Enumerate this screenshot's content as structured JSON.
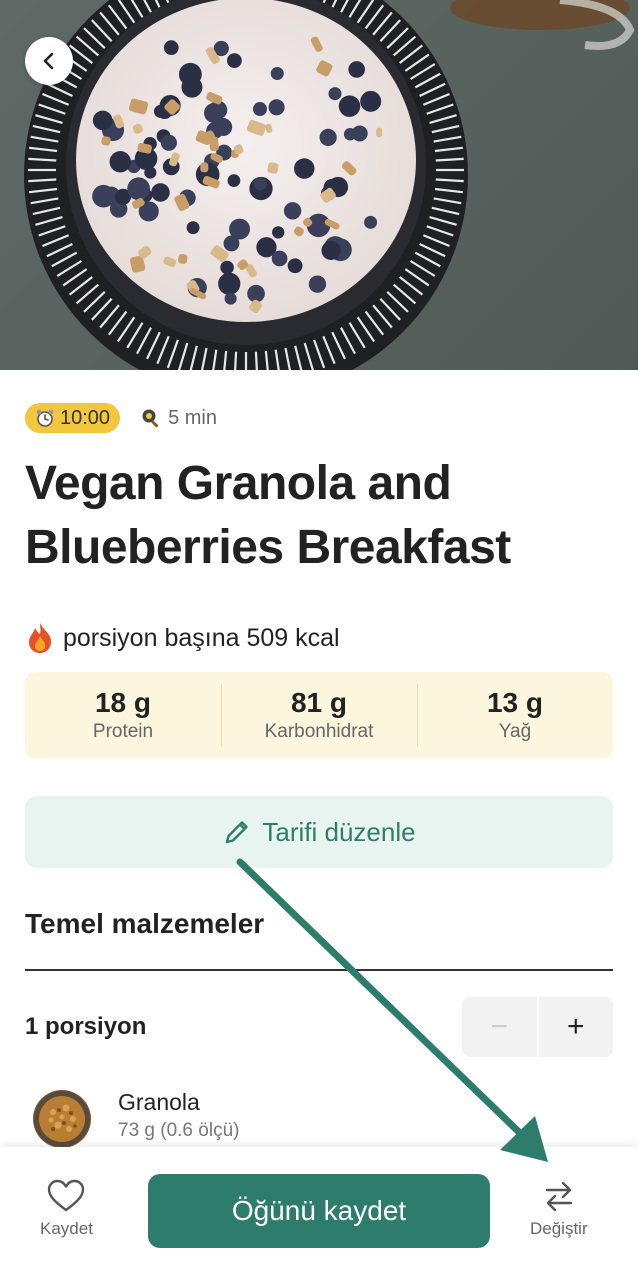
{
  "header": {
    "back_icon": "chevron-left-icon"
  },
  "meta": {
    "meal_time": "10:00",
    "meal_time_icon": "alarm-clock-icon",
    "cook_time": "5 min",
    "cook_icon": "frying-pan-icon"
  },
  "recipe": {
    "title": "Vegan Granola and Blueberries Breakfast"
  },
  "nutrition": {
    "kcal_icon": "fire-icon",
    "kcal_text": "porsiyon başına 509 kcal",
    "macros": [
      {
        "value": "18 g",
        "label": "Protein"
      },
      {
        "value": "81 g",
        "label": "Karbonhidrat"
      },
      {
        "value": "13 g",
        "label": "Yağ"
      }
    ]
  },
  "edit": {
    "label": "Tarifi düzenle",
    "icon": "pencil-icon"
  },
  "ingredients": {
    "section_title": "Temel malzemeler",
    "portion_label": "1 porsiyon",
    "minus": "−",
    "plus": "+",
    "items": [
      {
        "name": "Granola",
        "amount": "73 g (0.6 ölçü)"
      }
    ]
  },
  "bottom_bar": {
    "save_tab": "Kaydet",
    "primary_button": "Öğünü kaydet",
    "swap_tab": "Değiştir"
  },
  "colors": {
    "accent": "#2e7d6c",
    "time_badge": "#f3c73d",
    "macro_bg": "#fdf6df",
    "edit_bg": "#e8f4f0"
  }
}
